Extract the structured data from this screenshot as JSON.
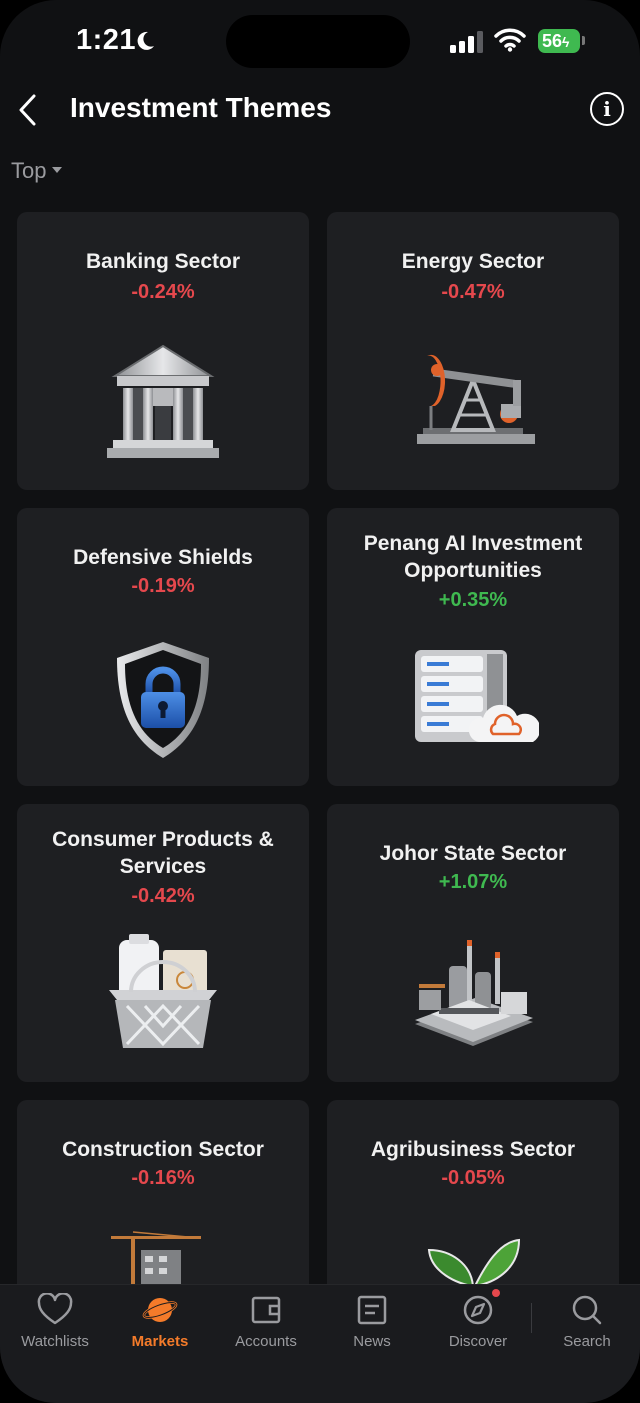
{
  "status_bar": {
    "time": "1:21",
    "battery": "56"
  },
  "header": {
    "title": "Investment Themes"
  },
  "sort": {
    "label": "Top"
  },
  "themes": [
    {
      "name": "Banking Sector",
      "change": "-0.24%",
      "direction": "down",
      "icon": "bank-building-icon"
    },
    {
      "name": "Energy Sector",
      "change": "-0.47%",
      "direction": "down",
      "icon": "oil-pump-jack-icon"
    },
    {
      "name": "Defensive Shields",
      "change": "-0.19%",
      "direction": "down",
      "icon": "shield-lock-icon"
    },
    {
      "name": "Penang AI Investment Opportunities",
      "change": "+0.35%",
      "direction": "up",
      "icon": "server-cloud-icon"
    },
    {
      "name": "Consumer Products & Services",
      "change": "-0.42%",
      "direction": "down",
      "icon": "shopping-basket-icon"
    },
    {
      "name": "Johor State Sector",
      "change": "+1.07%",
      "direction": "up",
      "icon": "factory-icon"
    },
    {
      "name": "Construction Sector",
      "change": "-0.16%",
      "direction": "down",
      "icon": "crane-building-icon"
    },
    {
      "name": "Agribusiness Sector",
      "change": "-0.05%",
      "direction": "down",
      "icon": "plant-sprout-icon"
    }
  ],
  "tabs": [
    {
      "label": "Watchlists",
      "icon": "heart-icon",
      "active": false
    },
    {
      "label": "Markets",
      "icon": "planet-icon",
      "active": true
    },
    {
      "label": "Accounts",
      "icon": "wallet-icon",
      "active": false
    },
    {
      "label": "News",
      "icon": "newspaper-icon",
      "active": false
    },
    {
      "label": "Discover",
      "icon": "compass-icon",
      "active": false
    },
    {
      "label": "Search",
      "icon": "search-icon",
      "active": false
    }
  ],
  "colors": {
    "negative": "#e5484d",
    "positive": "#3fb950",
    "accent": "#f47b2a",
    "card_bg": "#1e1f22",
    "page_bg": "#101113"
  }
}
